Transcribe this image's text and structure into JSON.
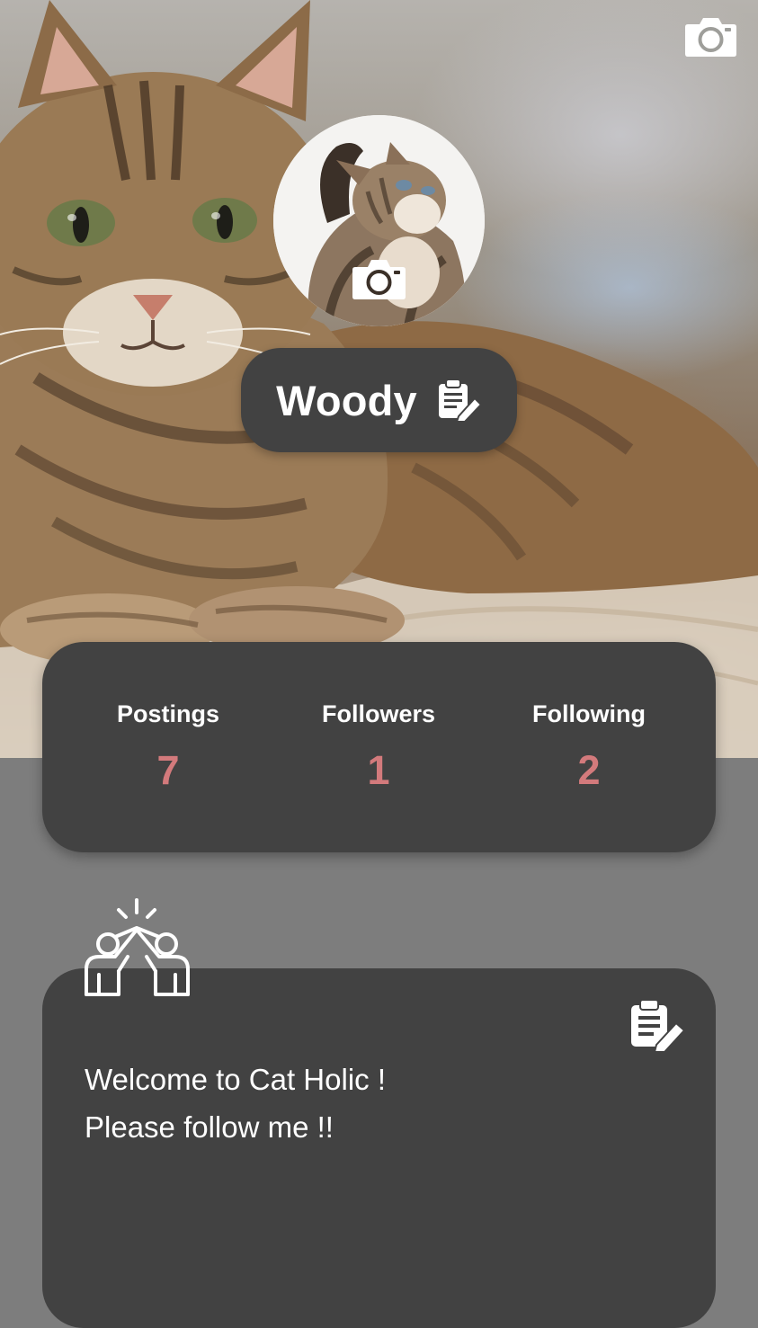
{
  "profile": {
    "name": "Woody",
    "cover_camera_icon": "camera-icon",
    "avatar_camera_icon": "camera-icon",
    "name_edit_icon": "edit-clipboard-icon"
  },
  "stats": [
    {
      "label": "Postings",
      "value": "7"
    },
    {
      "label": "Followers",
      "value": "1"
    },
    {
      "label": "Following",
      "value": "2"
    }
  ],
  "bio": {
    "lines": [
      "Welcome to Cat Holic !",
      "Please follow me !!"
    ],
    "decor_icon": "high-five-icon",
    "edit_icon": "edit-clipboard-icon"
  },
  "colors": {
    "background": "#7d7d7d",
    "card": "#424242",
    "stat_value": "#d37a7c",
    "text": "#ffffff"
  }
}
